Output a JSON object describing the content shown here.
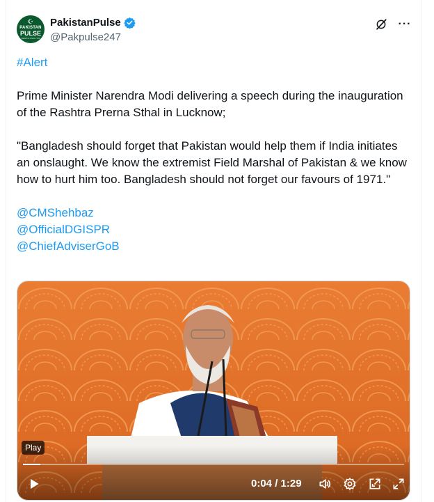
{
  "author": {
    "avatar_line1": "PAKISTAN",
    "avatar_line2": "PULSE",
    "avatar_line3": "NEWS & ANALYSIS",
    "display_name": "PakistanPulse",
    "handle": "@Pakpulse247",
    "verified": true
  },
  "post": {
    "hashtag": "#Alert",
    "paragraph1": "Prime Minister Narendra Modi delivering a speech during the inauguration of the Rashtra Prerna Sthal in Lucknow;",
    "paragraph2": "\"Bangladesh should forget that Pakistan would help them if India initiates an onslaught. We know the extremist Field Marshal of Pakistan & we know how to hurt him too. Bangladesh should not forget our favours of 1971.\"",
    "mentions": [
      "@CMShehbaz",
      "@OfficialDGISPR",
      "@ChiefAdviserGoB"
    ]
  },
  "video": {
    "tooltip": "Play",
    "current_time": "0:04",
    "separator": "/",
    "duration": "1:29",
    "progress_fraction": 0.045,
    "icons": [
      "play-icon",
      "volume-icon",
      "settings-icon",
      "picture-in-picture-icon",
      "fullscreen-icon"
    ]
  },
  "colors": {
    "link": "#1d9bf0",
    "verified": "#1d9bf0",
    "backdrop": "#e8762c",
    "avatar_bg": "#0b5a2e"
  }
}
